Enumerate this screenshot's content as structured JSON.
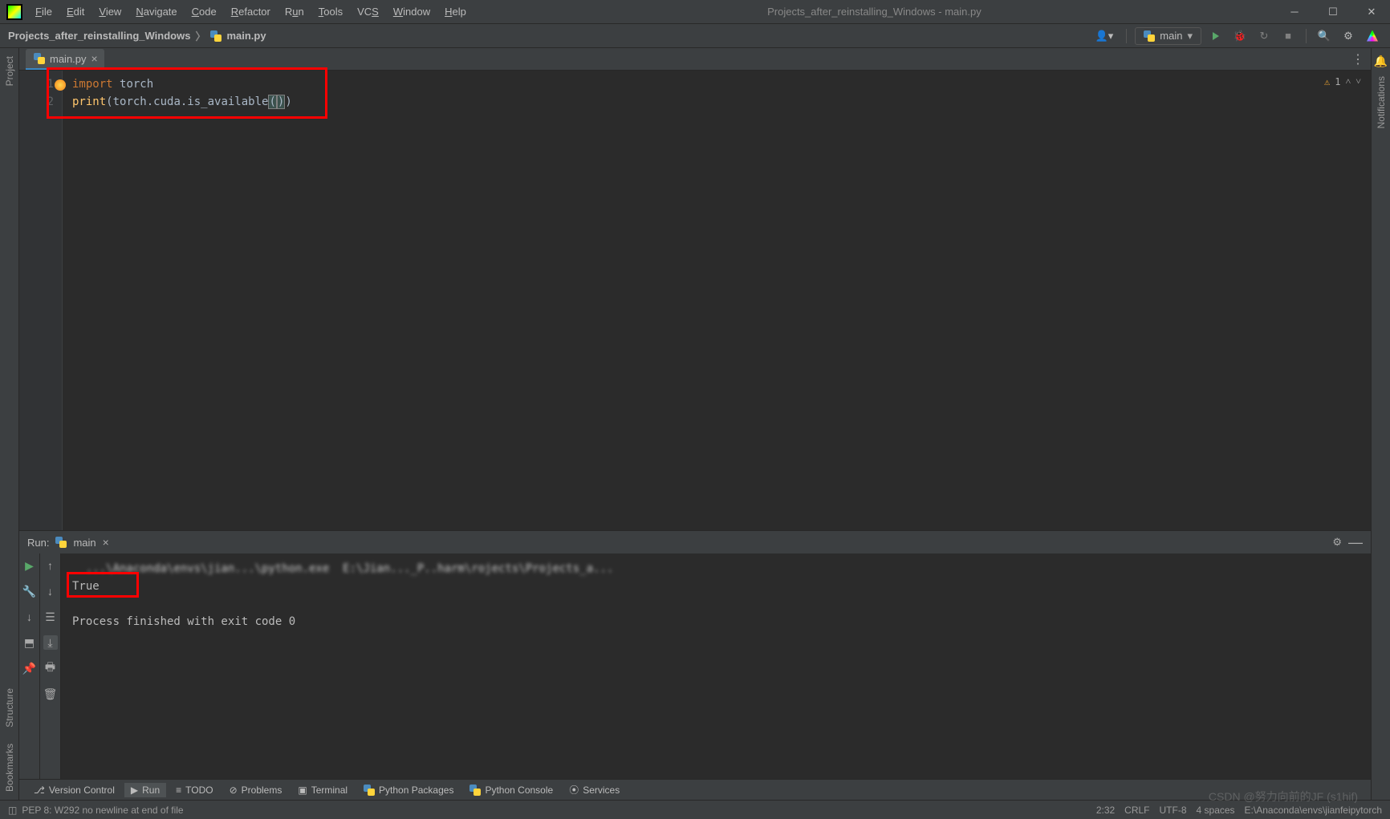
{
  "window_title": "Projects_after_reinstalling_Windows - main.py",
  "menubar": {
    "file": "File",
    "edit": "Edit",
    "view": "View",
    "navigate": "Navigate",
    "code": "Code",
    "refactor": "Refactor",
    "run": "Run",
    "tools": "Tools",
    "vcs": "VCS",
    "window": "Window",
    "help": "Help"
  },
  "breadcrumb": {
    "project": "Projects_after_reinstalling_Windows",
    "file": "main.py"
  },
  "run_config": {
    "label": "main"
  },
  "tab": {
    "name": "main.py"
  },
  "inspection": {
    "warn_count": "1"
  },
  "editor": {
    "lines": [
      "1",
      "2"
    ],
    "l1_kw": "import",
    "l1_mod": "torch",
    "l2_fn": "print",
    "l2_expr": "torch.cuda.is_available",
    "l2_p1": "(",
    "l2_p2": "(",
    "l2_p3": ")",
    "l2_p4": ")"
  },
  "left_rail": {
    "project": "Project",
    "structure": "Structure",
    "bookmarks": "Bookmarks"
  },
  "right_rail": {
    "notifications": "Notifications"
  },
  "run_panel": {
    "label": "Run:",
    "config": "main",
    "cmd_prefix": "  ...\\Anaconda\\envs\\jian...\\python.exe  E:\\Jian..._P..harm\\rojects\\Projects_a...",
    "out_true": "True",
    "blank": "",
    "exit": "Process finished with exit code 0"
  },
  "bottom_tools": {
    "version_control": "Version Control",
    "run": "Run",
    "todo": "TODO",
    "problems": "Problems",
    "terminal": "Terminal",
    "python_packages": "Python Packages",
    "python_console": "Python Console",
    "services": "Services"
  },
  "statusbar": {
    "pep8": "PEP 8: W292 no newline at end of file",
    "pos": "2:32",
    "sep": "CRLF",
    "enc": "UTF-8",
    "indent": "4 spaces",
    "interp": "E:\\Anaconda\\envs\\jianfeipytorch"
  },
  "watermark": "CSDN @努力向前的JF  (s1hif)"
}
